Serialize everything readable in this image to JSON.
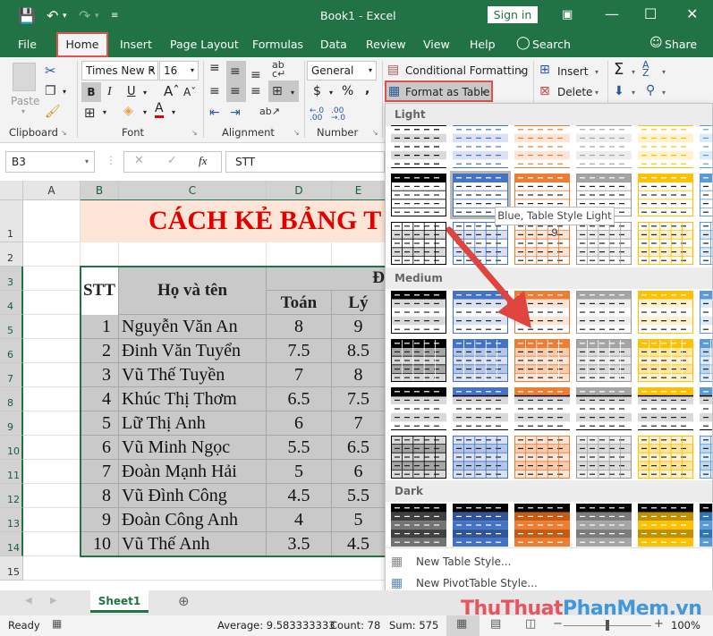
{
  "window": {
    "title": "Book1  -  Excel",
    "sign_in": "Sign in"
  },
  "ribbon_tabs": [
    "File",
    "Home",
    "Insert",
    "Page Layout",
    "Formulas",
    "Data",
    "Review",
    "View",
    "Help",
    "Search",
    "Share"
  ],
  "active_tab": "Home",
  "ribbon": {
    "clipboard": {
      "paste": "Paste",
      "label": "Clipboard"
    },
    "font": {
      "name": "Times New R",
      "size": "16",
      "label": "Font",
      "bold": "B",
      "italic": "I",
      "underline": "U"
    },
    "alignment": {
      "label": "Alignment"
    },
    "number": {
      "format": "General",
      "label": "Number",
      "currency": "$",
      "percent": "%",
      "comma": ","
    },
    "styles": {
      "conditional_formatting": "Conditional Formatting",
      "format_as_table": "Format as Table"
    },
    "cells": {
      "insert": "Insert",
      "delete": "Delete"
    }
  },
  "formula_bar": {
    "name_box": "B3",
    "fx": "fx",
    "content": "STT"
  },
  "grid": {
    "columns": [
      "A",
      "B",
      "C",
      "D",
      "E"
    ],
    "rows": [
      "1",
      "2",
      "3",
      "4",
      "5",
      "6",
      "7",
      "8",
      "9",
      "10",
      "11",
      "12",
      "13",
      "14",
      "15"
    ],
    "title": "CÁCH KẺ BẢNG T",
    "headers": {
      "stt": "STT",
      "name": "Họ và tên",
      "group": "Đ",
      "math": "Toán",
      "physics": "Lý"
    },
    "records": [
      {
        "stt": "1",
        "name": "Nguyễn Văn An",
        "math": "8",
        "physics": "9"
      },
      {
        "stt": "2",
        "name": "Đinh Văn Tuyển",
        "math": "7.5",
        "physics": "8.5"
      },
      {
        "stt": "3",
        "name": "Vũ Thế Tuyền",
        "math": "7",
        "physics": "8"
      },
      {
        "stt": "4",
        "name": "Khúc Thị Thơm",
        "math": "6.5",
        "physics": "7.5"
      },
      {
        "stt": "5",
        "name": "Lữ Thị Anh",
        "math": "6",
        "physics": "7"
      },
      {
        "stt": "6",
        "name": "Vũ Minh Ngọc",
        "math": "5.5",
        "physics": "6.5"
      },
      {
        "stt": "7",
        "name": "Đoàn Mạnh Hải",
        "math": "5",
        "physics": "6"
      },
      {
        "stt": "8",
        "name": "Vũ Đình Công",
        "math": "4.5",
        "physics": "5.5"
      },
      {
        "stt": "9",
        "name": "Đoàn Công Anh",
        "math": "4",
        "physics": "5"
      },
      {
        "stt": "10",
        "name": "Vũ Thế Anh",
        "math": "3.5",
        "physics": "4.5"
      }
    ]
  },
  "gallery": {
    "sections": [
      "Light",
      "Medium",
      "Dark"
    ],
    "tooltip": "Blue, Table Style Light 9",
    "palette": [
      {
        "name": "black",
        "main": "#000000",
        "light": "#d9d9d9",
        "mid": "#a6a6a6"
      },
      {
        "name": "blue",
        "main": "#4472c4",
        "light": "#d9e1f2",
        "mid": "#b4c6e7"
      },
      {
        "name": "orange",
        "main": "#ed7d31",
        "light": "#fce4d6",
        "mid": "#f8cbad"
      },
      {
        "name": "gray",
        "main": "#a5a5a5",
        "light": "#ededed",
        "mid": "#dbdbdb"
      },
      {
        "name": "gold",
        "main": "#ffc000",
        "light": "#fff2cc",
        "mid": "#ffe699"
      },
      {
        "name": "lightblue",
        "main": "#5b9bd5",
        "light": "#ddebf7",
        "mid": "#bdd7ee"
      }
    ],
    "dark_palette": [
      {
        "band1": "#404040",
        "band2": "#737373"
      },
      {
        "band1": "#2f5597",
        "band2": "#4472c4"
      },
      {
        "band1": "#c55a11",
        "band2": "#ed7d31"
      },
      {
        "band1": "#7b7b7b",
        "band2": "#a5a5a5"
      },
      {
        "band1": "#bf9000",
        "band2": "#ffc000"
      },
      {
        "band1": "#2e75b6",
        "band2": "#5b9bd5"
      }
    ],
    "new_table_style": "New Table Style...",
    "new_pivot_style": "New PivotTable Style..."
  },
  "sheet_tabs": {
    "active": "Sheet1"
  },
  "status": {
    "mode": "Ready",
    "average": "Average: 9.583333333",
    "count": "Count: 78",
    "sum": "Sum: 575",
    "zoom": "100%"
  },
  "watermark": {
    "part1": "ThuThuat",
    "part2": "PhanMem",
    "part3": ".vn"
  }
}
